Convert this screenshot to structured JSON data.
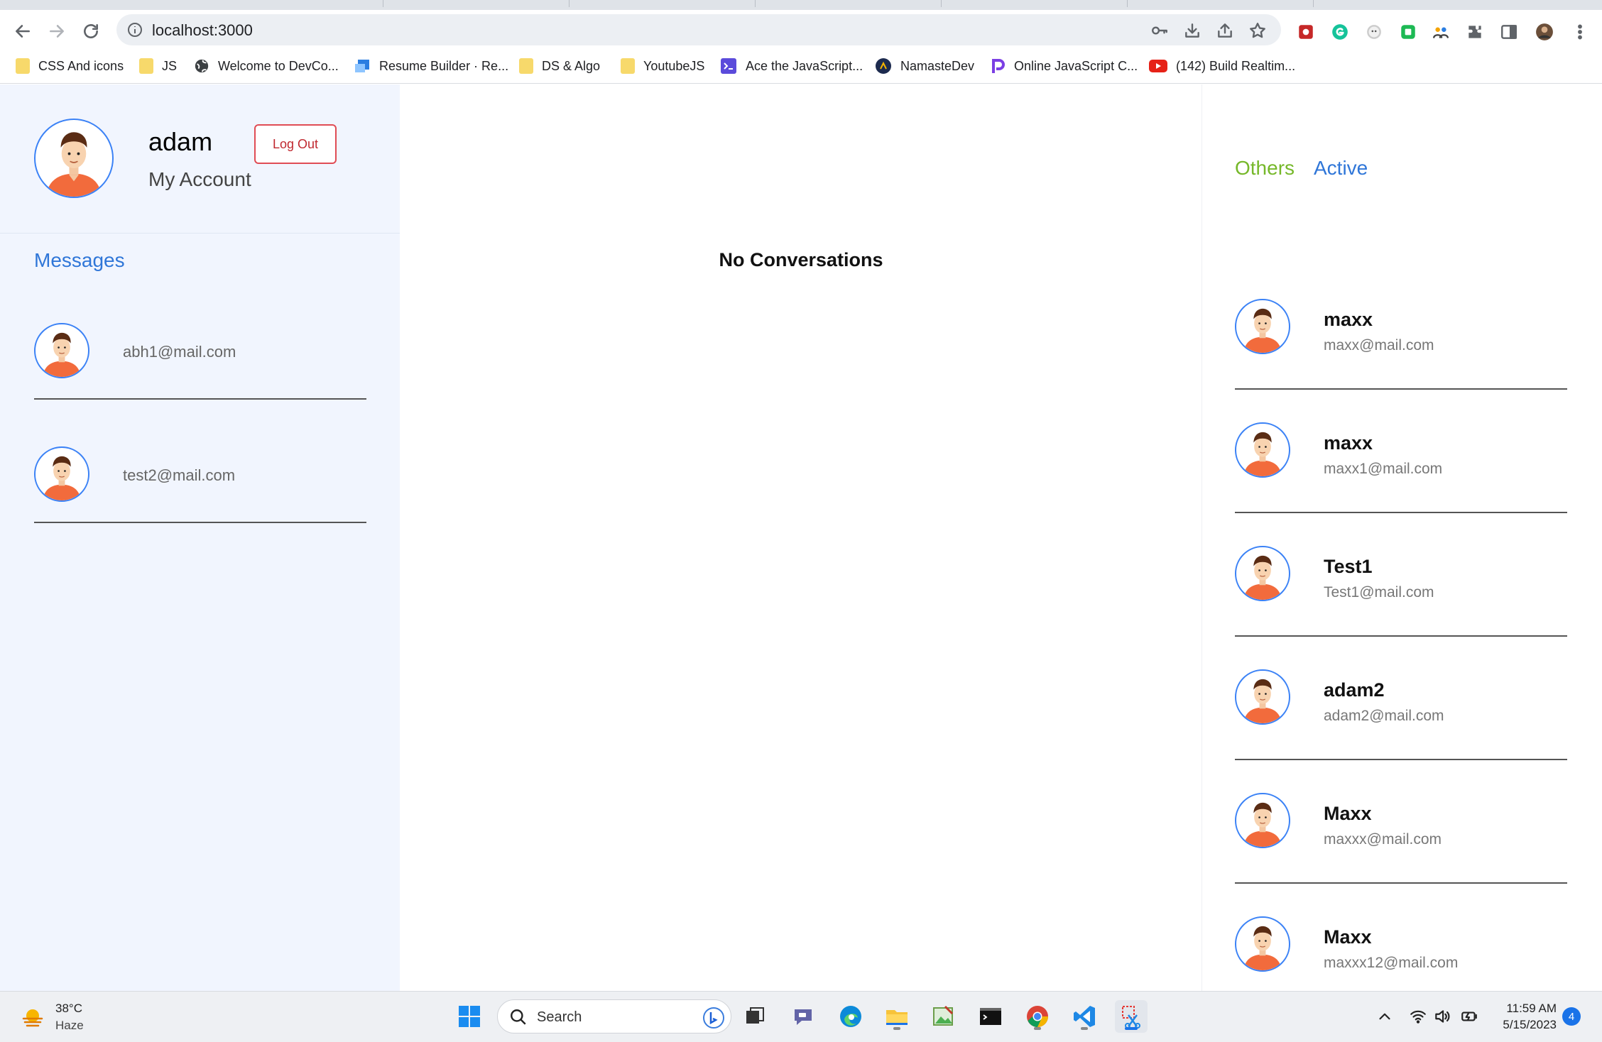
{
  "browser": {
    "url": "localhost:3000",
    "bookmarks": [
      {
        "label": "CSS And icons",
        "icon": "folder-icon"
      },
      {
        "label": "JS",
        "icon": "folder-icon"
      },
      {
        "label": "Welcome to DevCo...",
        "icon": "globe-icon"
      },
      {
        "label": "Resume Builder · Re...",
        "icon": "resume-builder-icon"
      },
      {
        "label": "DS & Algo",
        "icon": "folder-icon"
      },
      {
        "label": "YoutubeJS",
        "icon": "folder-icon"
      },
      {
        "label": "Ace the JavaScript...",
        "icon": "terminal-icon"
      },
      {
        "label": "NamasteDev",
        "icon": "namastedev-icon"
      },
      {
        "label": "Online JavaScript C...",
        "icon": "programiz-icon"
      },
      {
        "label": "(142) Build Realtim...",
        "icon": "youtube-icon"
      }
    ]
  },
  "profile": {
    "name": "adam",
    "subtitle": "My Account",
    "logout_label": "Log Out"
  },
  "messages": {
    "title": "Messages",
    "conversations": [
      {
        "email": "abh1@mail.com"
      },
      {
        "email": "test2@mail.com"
      }
    ]
  },
  "center": {
    "empty_text": "No Conversations"
  },
  "people": {
    "tab_others": "Others",
    "tab_active": "Active",
    "colors": {
      "others": "#76b82a",
      "active": "#2f76d8"
    },
    "users": [
      {
        "name": "maxx",
        "email": "maxx@mail.com"
      },
      {
        "name": "maxx",
        "email": "maxx1@mail.com"
      },
      {
        "name": "Test1",
        "email": "Test1@mail.com"
      },
      {
        "name": "adam2",
        "email": "adam2@mail.com"
      },
      {
        "name": "Maxx",
        "email": "maxxx@mail.com"
      },
      {
        "name": "Maxx",
        "email": "maxxx12@mail.com"
      }
    ]
  },
  "taskbar": {
    "temperature": "38°C",
    "condition": "Haze",
    "search_label": "Search",
    "time": "11:59 AM",
    "date": "5/15/2023",
    "notifications": "4"
  }
}
